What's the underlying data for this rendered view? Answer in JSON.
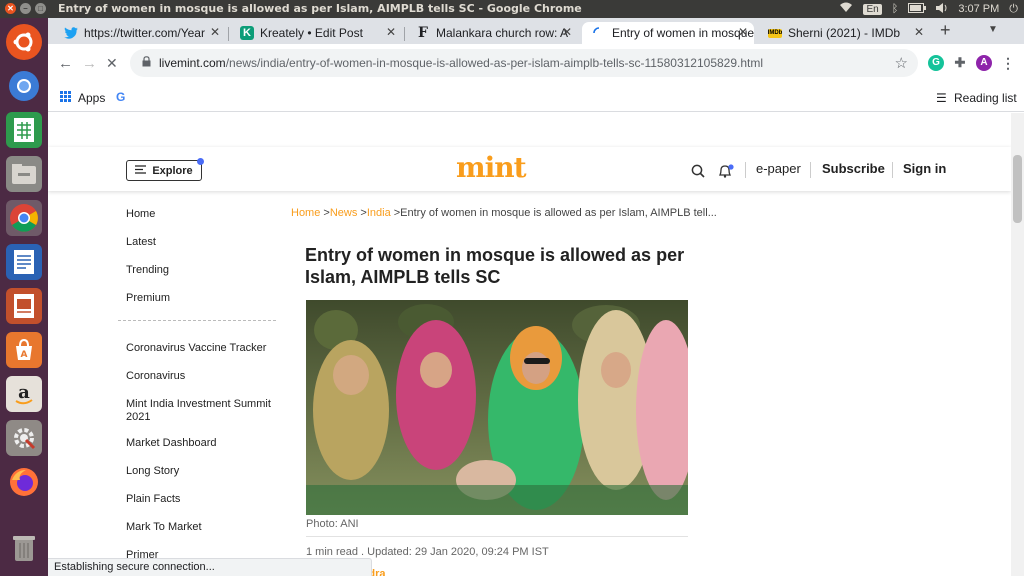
{
  "system": {
    "window_title": "Entry of women in mosque is allowed as per Islam, AIMPLB tells SC - Google Chrome",
    "language": "En",
    "time": "3:07 PM"
  },
  "launcher": {
    "items": [
      "ubuntu-logo-icon",
      "chromium-icon",
      "spreadsheet-icon",
      "file-manager-icon",
      "chrome-icon",
      "writer-icon",
      "impress-icon",
      "software-center-icon",
      "amazon-icon",
      "settings-icon",
      "firefox-icon",
      "trash-icon"
    ]
  },
  "tabs": [
    {
      "label": "https://twitter.com/Year",
      "icon": "twitter-icon",
      "active": false
    },
    {
      "label": "Kreately • Edit Post",
      "icon": "kreately-icon",
      "active": false
    },
    {
      "label": "Malankara church row: A",
      "icon": "firstpost-icon",
      "active": false
    },
    {
      "label": "Entry of women in mosque",
      "icon": "loading-spinner-icon",
      "active": true
    },
    {
      "label": "Sherni (2021) - IMDb",
      "icon": "imdb-icon",
      "active": false
    }
  ],
  "address_bar": {
    "host": "livemint.com",
    "path": "/news/india/entry-of-women-in-mosque-is-allowed-as-per-islam-aimplb-tells-sc-11580312105829.html"
  },
  "bookmarks": {
    "apps_label": "Apps",
    "google_label": "G",
    "reading_list_label": "Reading list"
  },
  "profile": {
    "initial": "A"
  },
  "header": {
    "explore_label": "Explore",
    "logo_text": "mint",
    "epaper_label": "e-paper",
    "subscribe_label": "Subscribe",
    "signin_label": "Sign in"
  },
  "sidenav": {
    "primary": [
      "Home",
      "Latest",
      "Trending",
      "Premium"
    ],
    "secondary": [
      "Coronavirus Vaccine Tracker",
      "Coronavirus",
      "Mint India Investment Summit 2021",
      "Market Dashboard",
      "Long Story",
      "Plain Facts",
      "Mark To Market",
      "Primer"
    ]
  },
  "breadcrumb": {
    "home": "Home",
    "sep1": " >",
    "news": "News",
    "sep2": " >",
    "india": "India",
    "current": " >Entry of women in mosque is allowed as per Islam, AIMPLB tell..."
  },
  "article": {
    "headline": "Entry of women in mosque is allowed as per Islam, AIMPLB tells SC",
    "caption": "Photo: ANI",
    "meta": "1 min read . Updated: 29 Jan 2020, 09:24 PM IST",
    "author": "Japnam Bindra"
  },
  "status_bar": "Establishing secure connection..."
}
